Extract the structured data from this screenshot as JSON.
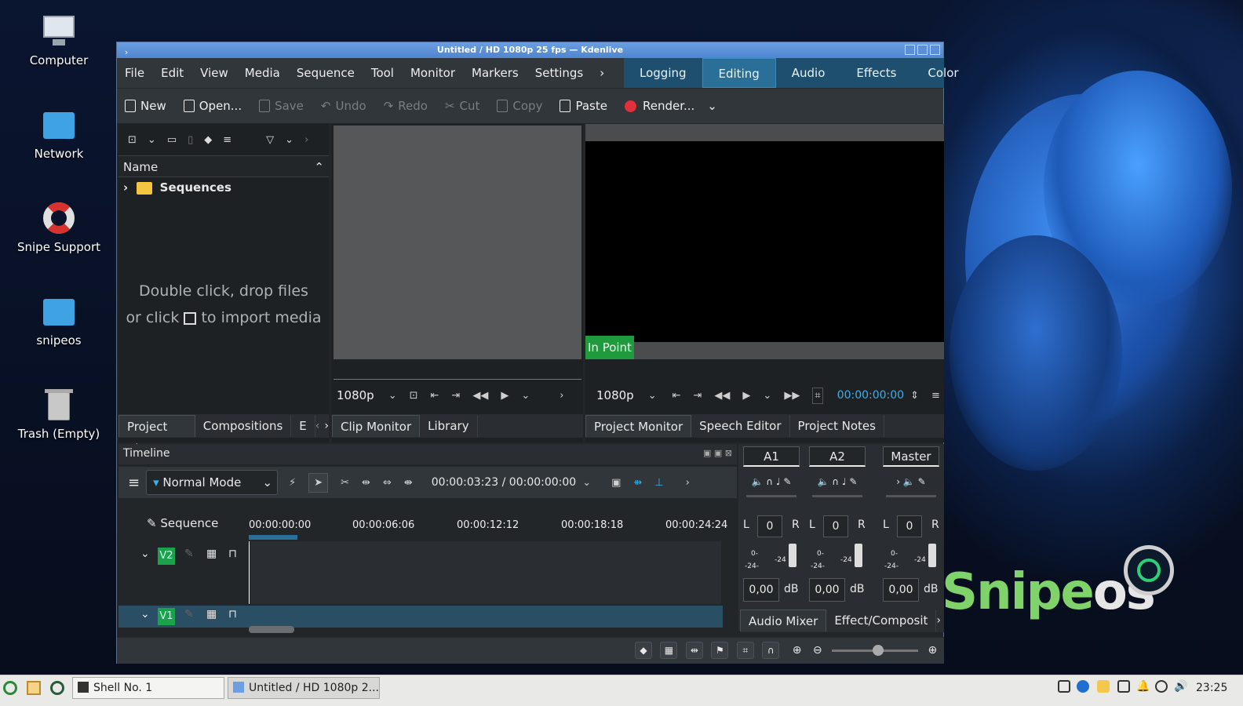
{
  "desktop": {
    "icons": [
      {
        "label": "Computer"
      },
      {
        "label": "Network"
      },
      {
        "label": "Snipe Support"
      },
      {
        "label": "snipeos"
      },
      {
        "label": "Trash (Empty)"
      }
    ],
    "brand_text": "Snipe",
    "brand_os": "os"
  },
  "window": {
    "title": "Untitled / HD 1080p 25 fps — Kdenlive"
  },
  "menu": {
    "items": [
      "File",
      "Edit",
      "View",
      "Media",
      "Sequence",
      "Tool",
      "Monitor",
      "Markers",
      "Settings"
    ],
    "more": "›"
  },
  "workspaces": {
    "tabs": [
      "Logging",
      "Editing",
      "Audio",
      "Effects",
      "Color"
    ],
    "active": "Editing"
  },
  "toolbar": {
    "new": "New",
    "open": "Open...",
    "save": "Save",
    "undo": "Undo",
    "redo": "Redo",
    "cut": "Cut",
    "copy": "Copy",
    "paste": "Paste",
    "render": "Render..."
  },
  "bin": {
    "column": "Name",
    "folder": "Sequences",
    "hint_line1": "Double click, drop files",
    "hint_line2_a": "or click",
    "hint_line2_b": "to import media",
    "tabs": [
      "Project Bin",
      "Compositions",
      "E"
    ]
  },
  "clip_monitor": {
    "resolution": "1080p",
    "tabs": [
      "Clip Monitor",
      "Library"
    ]
  },
  "project_monitor": {
    "resolution": "1080p",
    "timecode": "00:00:00:00",
    "in_point": "In Point",
    "tabs": [
      "Project Monitor",
      "Speech Editor",
      "Project Notes"
    ]
  },
  "timeline": {
    "title": "Timeline",
    "mode": "Normal Mode",
    "position": "00:00:03:23 / 00:00:00:00",
    "sequence_label": "Sequence",
    "ruler": [
      "00:00:00:00",
      "00:00:06:06",
      "00:00:12:12",
      "00:00:18:18",
      "00:00:24:24"
    ],
    "tracks": [
      {
        "name": "V2"
      },
      {
        "name": "V1"
      }
    ]
  },
  "mixer": {
    "channels": [
      {
        "name": "A1",
        "volume": "0",
        "db": "0,00"
      },
      {
        "name": "A2",
        "volume": "0",
        "db": "0,00"
      },
      {
        "name": "Master",
        "volume": "0",
        "db": "0,00"
      }
    ],
    "l": "L",
    "r": "R",
    "db_unit": "dB",
    "meter_0": "0-",
    "meter_24a": "-24-",
    "meter_24b": "-24",
    "tabs": [
      "Audio Mixer",
      "Effect/Composit"
    ]
  },
  "taskbar": {
    "tasks": [
      "Shell No. 1",
      "Untitled / HD 1080p 2..."
    ],
    "clock": "23:25"
  },
  "colors": {
    "accent": "#2a6f98",
    "green": "#1aa34a",
    "timecode": "#3daee9"
  }
}
